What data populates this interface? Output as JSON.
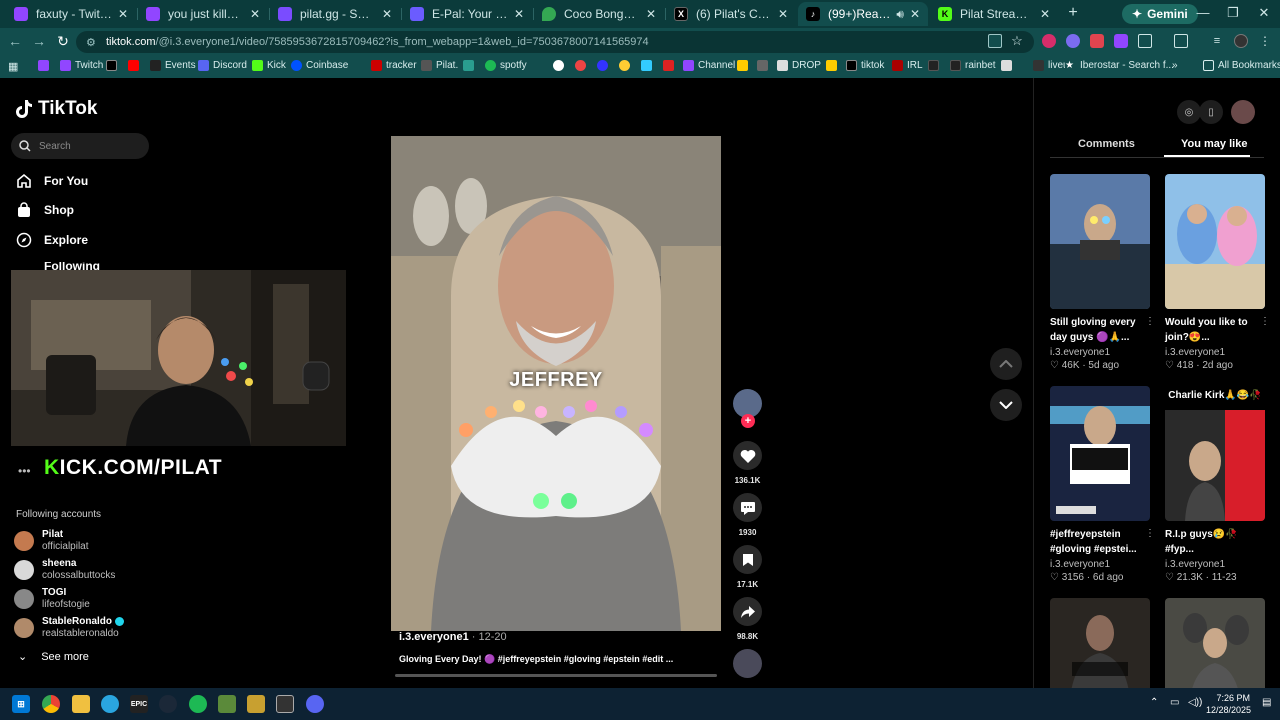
{
  "browser": {
    "tabs": [
      {
        "title": "faxuty - Twitch",
        "favicon_color": "#9146ff"
      },
      {
        "title": "you just killed me you -",
        "favicon_color": "#9146ff"
      },
      {
        "title": "pilat.gg - Shuffle Leade",
        "favicon_color": "#7a4cff"
      },
      {
        "title": "E-Pal: Your Kind Teamm",
        "favicon_color": "#6b5cff"
      },
      {
        "title": "Coco Bongo - Google M",
        "favicon_color": "#34a853"
      },
      {
        "title": "(6) Pilat's Community C",
        "favicon_color": "#000000"
      },
      {
        "title": "(99+)Real Gloving T",
        "favicon_color": "#000000",
        "active": true
      },
      {
        "title": "Pilat Stream - Watch Liv",
        "favicon_color": "#53fc18"
      }
    ],
    "new_tab": "+",
    "gemini_label": "Gemini",
    "url_domain": "tiktok.com",
    "url_path": "/@i.3.everyone1/video/7585953672815709462?is_from_webapp=1&web_id=7503678007141565974",
    "bookmarks": [
      "Twitch",
      "Events",
      "Discord",
      "Kick",
      "Coinbase",
      "tracker",
      "Pilat.",
      "spotfy",
      "Channel",
      "DROP",
      "tiktok",
      "IRL",
      "rainbet",
      "liveu",
      "Iberostar - Search f..."
    ],
    "all_bookmarks": "All Bookmarks"
  },
  "tiktok": {
    "logo": "TikTok",
    "search_placeholder": "Search",
    "nav": [
      "For You",
      "Shop",
      "Explore",
      "Following"
    ],
    "kick_overlay": {
      "prefix": "K",
      "text": "ICK.COM/PILAT"
    },
    "following_header": "Following accounts",
    "accounts": [
      {
        "name": "Pilat",
        "handle": "officialpilat",
        "color": "#c47a4f"
      },
      {
        "name": "sheena",
        "handle": "colossalbuttocks",
        "color": "#d9d9d9"
      },
      {
        "name": "TOGI",
        "handle": "lifeofstogie",
        "color": "#888888"
      },
      {
        "name": "StableRonaldo",
        "handle": "realstableronaldo",
        "color": "#b08a6a",
        "verified": true
      }
    ],
    "see_more": "See more",
    "video": {
      "caption_overlay": "JEFFREY",
      "author": "i.3.everyone1",
      "date": "12-20",
      "description": "Gloving Every Day! 🟣 #jeffreyepstein #gloving #epstein #edit ...",
      "likes": "136.1K",
      "comments": "1930",
      "saves": "17.1K",
      "shares": "98.8K"
    },
    "right_panel": {
      "tabs": [
        "Comments",
        "You may like"
      ],
      "selected_tab": "You may like",
      "cards": [
        {
          "title": "Still gloving every day guys 🟣🙏...",
          "user": "i.3.everyone1",
          "stats": "♡ 46K · 5d ago"
        },
        {
          "title": "Would you like to join?😍...",
          "user": "i.3.everyone1",
          "stats": "♡ 418 · 2d ago"
        },
        {
          "title": "#jeffreyepstein #gloving #epstei...",
          "user": "i.3.everyone1",
          "stats": "♡ 3156 · 6d ago"
        },
        {
          "title": "R.I.p guys😢🥀 #fyp...",
          "user": "i.3.everyone1",
          "stats": "♡ 21.3K · 11-23",
          "top_label": "Charlie Kirk🙏😂🥀"
        },
        {
          "title": "",
          "user": "",
          "stats": ""
        },
        {
          "title": "",
          "user": "",
          "stats": ""
        }
      ]
    }
  },
  "taskbar": {
    "time": "7:26 PM",
    "date": "12/28/2025"
  }
}
